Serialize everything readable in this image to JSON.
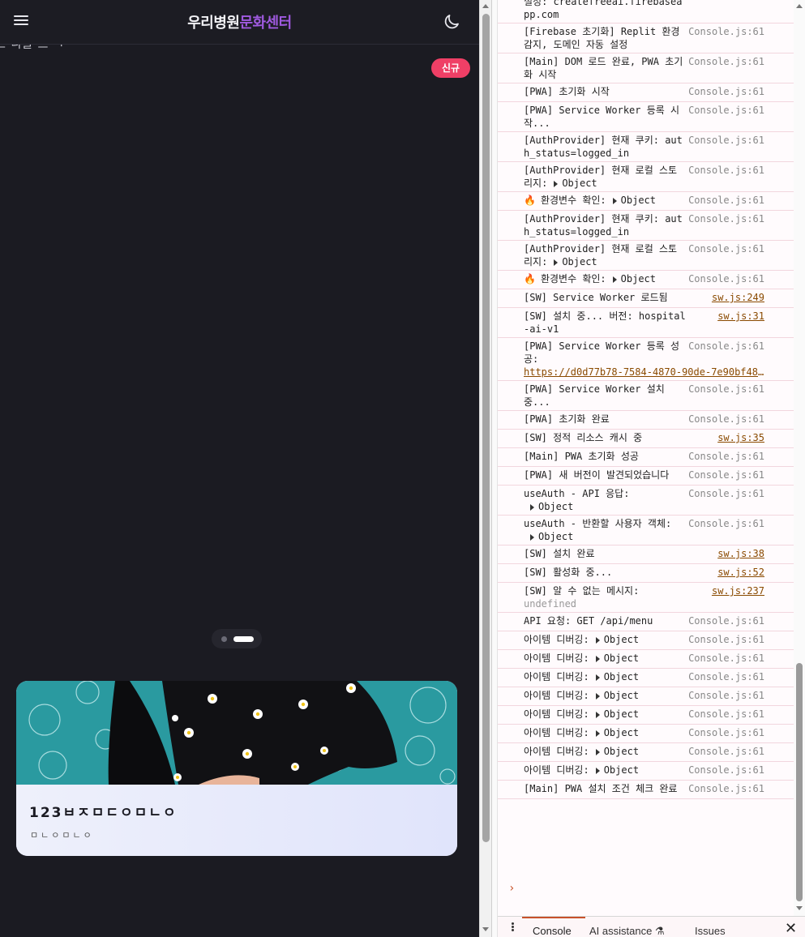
{
  "app": {
    "title_part1": "우리병원",
    "title_part2": "문화센터",
    "hero_cut_text": "스 니글 드 ㅋ",
    "new_badge": "신규",
    "card": {
      "title": "123ㅂㅈㅁㄷㅇㅁㄴㅇ",
      "subtitle": "ㅁㄴㅇㅁㄴㅇ"
    },
    "colors": {
      "background": "#1b1b22",
      "accent": "#a05ae0",
      "badge": "#ef3f66"
    },
    "icons": {
      "menu": "hamburger-icon",
      "theme": "moon-icon"
    }
  },
  "console": {
    "logs": [
      {
        "msg": "설정: createfreeai.firebaseapp.com",
        "src": ""
      },
      {
        "msg": "[Firebase 초기화] Replit 환경 감지, 도메인 자동 설정",
        "src": "Console.js:61"
      },
      {
        "msg": "[Main] DOM 로드 완료, PWA 초기화 시작",
        "src": "Console.js:61"
      },
      {
        "msg": "[PWA] 초기화 시작",
        "src": "Console.js:61"
      },
      {
        "msg": "[PWA] Service Worker 등록 시작...",
        "src": "Console.js:61"
      },
      {
        "msg": "[AuthProvider] 현재 쿠키: auth_status=logged_in",
        "src": "Console.js:61"
      },
      {
        "msg": "[AuthProvider] 현재 로컬 스토리지:",
        "obj": "Object",
        "src": "Console.js:61"
      },
      {
        "msg": "환경변수 확인:",
        "fire": true,
        "obj": "Object",
        "src": "Console.js:61"
      },
      {
        "msg": "[AuthProvider] 현재 쿠키: auth_status=logged_in",
        "src": "Console.js:61"
      },
      {
        "msg": "[AuthProvider] 현재 로컬 스토리지:",
        "obj": "Object",
        "src": "Console.js:61"
      },
      {
        "msg": "환경변수 확인:",
        "fire": true,
        "obj": "Object",
        "src": "Console.js:61"
      },
      {
        "msg": "[SW] Service Worker 로드됨",
        "src": "sw.js:249",
        "link": true
      },
      {
        "msg": "[SW] 설치 중... 버전: hospital-ai-v1",
        "src": "sw.js:31",
        "link": true
      },
      {
        "msg": "[PWA] Service Worker 등록 성공:",
        "url": "https://d0d77b78-7584-4870-90de-7e90bf483…",
        "src": "Console.js:61"
      },
      {
        "msg": "[PWA] Service Worker 설치 중...",
        "src": "Console.js:61"
      },
      {
        "msg": "[PWA] 초기화 완료",
        "src": "Console.js:61"
      },
      {
        "msg": "[SW] 정적 리소스 캐시 중",
        "src": "sw.js:35",
        "link": true
      },
      {
        "msg": "[Main] PWA 초기화 성공",
        "src": "Console.js:61"
      },
      {
        "msg": "[PWA] 새 버전이 발견되었습니다",
        "src": "Console.js:61"
      },
      {
        "msg": "useAuth - API 응답:",
        "obj": "Object",
        "objNewLine": true,
        "src": "Console.js:61"
      },
      {
        "msg": "useAuth - 반환할 사용자 객체:",
        "obj": "Object",
        "src": "Console.js:61"
      },
      {
        "msg": "[SW] 설치 완료",
        "src": "sw.js:38",
        "link": true
      },
      {
        "msg": "[SW] 활성화 중...",
        "src": "sw.js:52",
        "link": true
      },
      {
        "msg": "[SW] 알 수 없는 메시지:",
        "undef": "undefined",
        "src": "sw.js:237",
        "link": true
      },
      {
        "msg": "API 요청: GET /api/menu",
        "src": "Console.js:61"
      },
      {
        "msg": "아이템 디버깅:",
        "obj": "Object",
        "src": "Console.js:61"
      },
      {
        "msg": "아이템 디버깅:",
        "obj": "Object",
        "src": "Console.js:61"
      },
      {
        "msg": "아이템 디버깅:",
        "obj": "Object",
        "src": "Console.js:61"
      },
      {
        "msg": "아이템 디버깅:",
        "obj": "Object",
        "src": "Console.js:61"
      },
      {
        "msg": "아이템 디버깅:",
        "obj": "Object",
        "src": "Console.js:61"
      },
      {
        "msg": "아이템 디버깅:",
        "obj": "Object",
        "src": "Console.js:61"
      },
      {
        "msg": "아이템 디버깅:",
        "obj": "Object",
        "src": "Console.js:61"
      },
      {
        "msg": "아이템 디버깅:",
        "obj": "Object",
        "src": "Console.js:61"
      },
      {
        "msg": "[Main] PWA 설치 조건 체크 완료",
        "src": "Console.js:61"
      }
    ],
    "prompt": "›"
  },
  "drawer": {
    "tabs": [
      "Console",
      "AI assistance",
      "Issues"
    ],
    "ai_icon": "flask-icon",
    "close": "✕"
  }
}
